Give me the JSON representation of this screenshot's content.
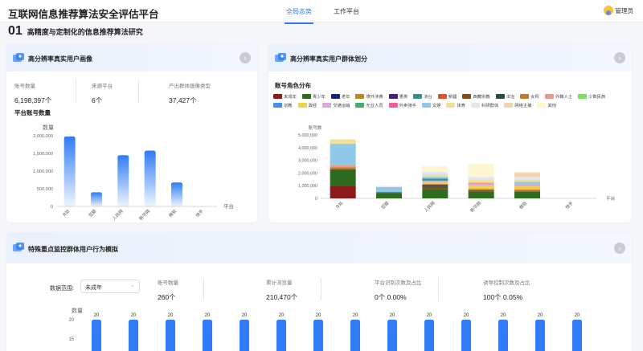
{
  "header": {
    "title": "互联网信息推荐算法安全评估平台",
    "tabs": [
      {
        "label": "全局态势",
        "active": true
      },
      {
        "label": "工作平台",
        "active": false
      }
    ],
    "user": "管理员"
  },
  "section": {
    "number": "01",
    "title": "高精度与定制化的信息推荐算法研究"
  },
  "card_portrait": {
    "title": "高分辨率真实用户画像",
    "stats": [
      {
        "label": "账号数量",
        "value": "6,198,397个"
      },
      {
        "label": "来源平台",
        "value": "6个"
      },
      {
        "label": "产出群体画像类型",
        "value": "37,427个"
      }
    ],
    "chart_title": "平台账号数量"
  },
  "card_group": {
    "title": "高分辨率真实用户群体划分",
    "chart_title": "账号角色分布"
  },
  "card_behavior": {
    "title": "特殊重点监控群体用户行为模拟",
    "filter_label": "数据范围:",
    "filter_value": "未成年",
    "stats": [
      {
        "label": "账号数量",
        "value": "260个"
      },
      {
        "label": "累计浏览量",
        "value": "210,470个"
      },
      {
        "label": "平台识别次数及占比",
        "value": "0个 0.00%"
      },
      {
        "label": "诱导控制次数及占比",
        "value": "100个 0.05%"
      }
    ]
  },
  "chart_data": [
    {
      "type": "bar",
      "ylabel": "数量",
      "xlabel": "平台",
      "categories": [
        "B站",
        "豆瓣",
        "人民网",
        "新华网",
        "微软",
        "快手"
      ],
      "values": [
        1980000,
        400000,
        1450000,
        1580000,
        680000,
        0
      ],
      "ylim": [
        0,
        2000000
      ],
      "yticks": [
        "0",
        "500,000",
        "1,000,000",
        "1,500,000",
        "2,000,000"
      ],
      "color": "#2f7cf6"
    },
    {
      "type": "bar",
      "stacked": true,
      "ylabel": "账号数",
      "xlabel": "平台",
      "categories": [
        "B站",
        "豆瓣",
        "人民网",
        "新华网",
        "微软",
        "快手"
      ],
      "ylim": [
        0,
        5000000
      ],
      "yticks": [
        "0",
        "1,000,000",
        "2,000,000",
        "3,000,000",
        "4,000,000",
        "5,000,000"
      ],
      "legend": [
        {
          "name": "未成年",
          "color": "#8b1a1a"
        },
        {
          "name": "青少年",
          "color": "#2e6b1f"
        },
        {
          "name": "老年",
          "color": "#1a237e"
        },
        {
          "name": "境外涉黄",
          "color": "#b8892b"
        },
        {
          "name": "愚类",
          "color": "#4a1f7a"
        },
        {
          "name": "涉台",
          "color": "#3a8f8f"
        },
        {
          "name": "新疆",
          "color": "#e0522b"
        },
        {
          "name": "西藏宗教",
          "color": "#8a4a16"
        },
        {
          "name": "法治",
          "color": "#2f4a4a"
        },
        {
          "name": "女权",
          "color": "#c7762a"
        },
        {
          "name": "外籍人士",
          "color": "#e99a8a"
        },
        {
          "name": "少数民族",
          "color": "#7be35a"
        },
        {
          "name": "宗教",
          "color": "#4a8ee6"
        },
        {
          "name": "政经",
          "color": "#f0d24a"
        },
        {
          "name": "交通运输",
          "color": "#d9a6e0"
        },
        {
          "name": "无业人员",
          "color": "#4aa86a"
        },
        {
          "name": "外卖骑手",
          "color": "#ef5f9a"
        },
        {
          "name": "文娱",
          "color": "#8ec9e8"
        },
        {
          "name": "体育",
          "color": "#efe19a"
        },
        {
          "name": "科研群体",
          "color": "#e6e6f2"
        },
        {
          "name": "网络主播",
          "color": "#f0d6a8"
        },
        {
          "name": "其他",
          "color": "#fdf6cf"
        }
      ],
      "stacks": [
        [
          {
            "c": "#8b1a1a",
            "v": 950000
          },
          {
            "c": "#2e6b1f",
            "v": 1350000
          },
          {
            "c": "#c7762a",
            "v": 150000
          },
          {
            "c": "#e99a8a",
            "v": 150000
          },
          {
            "c": "#8ec9e8",
            "v": 1700000
          },
          {
            "c": "#efe19a",
            "v": 350000
          }
        ],
        [
          {
            "c": "#2e6b1f",
            "v": 430000
          },
          {
            "c": "#2f4a4a",
            "v": 60000
          },
          {
            "c": "#8ec9e8",
            "v": 400000
          },
          {
            "c": "#e6e6f2",
            "v": 80000
          }
        ],
        [
          {
            "c": "#2e6b1f",
            "v": 750000
          },
          {
            "c": "#8a4a16",
            "v": 150000
          },
          {
            "c": "#2f4a4a",
            "v": 150000
          },
          {
            "c": "#e0522b",
            "v": 80000
          },
          {
            "c": "#f0d24a",
            "v": 150000
          },
          {
            "c": "#d9a6e0",
            "v": 120000
          },
          {
            "c": "#3a8f8f",
            "v": 150000
          },
          {
            "c": "#8ec9e8",
            "v": 150000
          },
          {
            "c": "#efe19a",
            "v": 200000
          },
          {
            "c": "#e6e6f2",
            "v": 200000
          },
          {
            "c": "#fdf6cf",
            "v": 450000
          }
        ],
        [
          {
            "c": "#2e6b1f",
            "v": 550000
          },
          {
            "c": "#8a4a16",
            "v": 100000
          },
          {
            "c": "#c7762a",
            "v": 100000
          },
          {
            "c": "#f0d24a",
            "v": 250000
          },
          {
            "c": "#d9a6e0",
            "v": 150000
          },
          {
            "c": "#e99a8a",
            "v": 100000
          },
          {
            "c": "#efe19a",
            "v": 250000
          },
          {
            "c": "#e6e6f2",
            "v": 200000
          },
          {
            "c": "#fdf6cf",
            "v": 1000000
          }
        ],
        [
          {
            "c": "#2e6b1f",
            "v": 550000
          },
          {
            "c": "#c7762a",
            "v": 150000
          },
          {
            "c": "#f0d24a",
            "v": 250000
          },
          {
            "c": "#d9a6e0",
            "v": 150000
          },
          {
            "c": "#8ec9e8",
            "v": 200000
          },
          {
            "c": "#efe19a",
            "v": 200000
          },
          {
            "c": "#e6e6f2",
            "v": 200000
          },
          {
            "c": "#f0d6a8",
            "v": 350000
          }
        ],
        []
      ]
    },
    {
      "type": "bar",
      "ylabel": "数量",
      "values": [
        20,
        20,
        20,
        20,
        20,
        20,
        20,
        20,
        20,
        20,
        20,
        20,
        20,
        20
      ],
      "yticks": [
        "20",
        "15"
      ],
      "color": "#2f7cf6"
    }
  ]
}
